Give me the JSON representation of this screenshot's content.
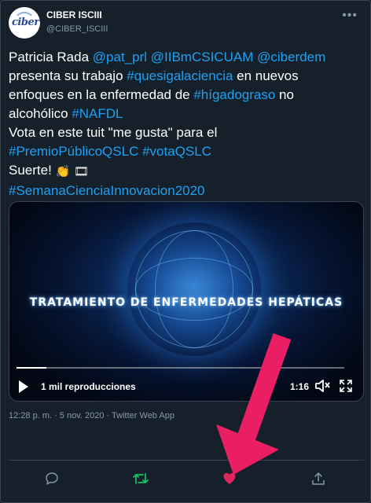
{
  "account": {
    "name": "CIBER ISCIII",
    "handle": "@CIBER_ISCIII",
    "avatar_text": "ciber",
    "more_icon": "more-horizontal-icon"
  },
  "tweet": {
    "line1": [
      {
        "t": "Patricia Rada ",
        "link": false
      },
      {
        "t": "@pat_prl",
        "link": true
      },
      {
        "t": " ",
        "link": false
      },
      {
        "t": "@IIBmCSICUAM",
        "link": true
      },
      {
        "t": " ",
        "link": false
      },
      {
        "t": "@ciberdem",
        "link": true
      }
    ],
    "line2": [
      {
        "t": "presenta su trabajo ",
        "link": false
      },
      {
        "t": "#quesigalaciencia",
        "link": true
      },
      {
        "t": " en nuevos",
        "link": false
      }
    ],
    "line3": [
      {
        "t": "enfoques en la enfermedad de ",
        "link": false
      },
      {
        "t": "#hígadograso",
        "link": true
      },
      {
        "t": " no",
        "link": false
      }
    ],
    "line4": [
      {
        "t": "alcohólico ",
        "link": false
      },
      {
        "t": "#NAFDL",
        "link": true
      }
    ],
    "line5": [
      {
        "t": "Vota en este tuit \"me gusta\" para el",
        "link": false
      }
    ],
    "line6": [
      {
        "t": "#PremioPúblicoQSLC",
        "link": true
      },
      {
        "t": " ",
        "link": false
      },
      {
        "t": "#votaQSLC",
        "link": true
      }
    ],
    "line7_text": "Suerte! ",
    "emoji_clap": "👏",
    "emoji_film": "🎞",
    "line8": [
      {
        "t": "#SemanaCienciaInnovacion2020",
        "link": true
      }
    ]
  },
  "video": {
    "title": "TRATAMIENTO DE ENFERMEDADES HEPÁTICAS",
    "views": "1 mil reproducciones",
    "duration": "1:16",
    "progress": 0.09,
    "icons": [
      "play-icon",
      "volume-icon",
      "fullscreen-icon"
    ]
  },
  "meta": {
    "timestamp": "12:28 p. m. · 5 nov. 2020 · Twitter Web App"
  },
  "actions": {
    "icons": [
      "reply-icon",
      "retweet-icon",
      "like-icon",
      "share-icon"
    ],
    "retweet_color": "#17bf63",
    "like_color": "#e0245e",
    "muted_color": "#8899a6"
  },
  "colors": {
    "background": "#15202b",
    "link": "#1da1f2",
    "secondary_text": "#8899a6",
    "annotation_arrow": "#e91e63"
  }
}
